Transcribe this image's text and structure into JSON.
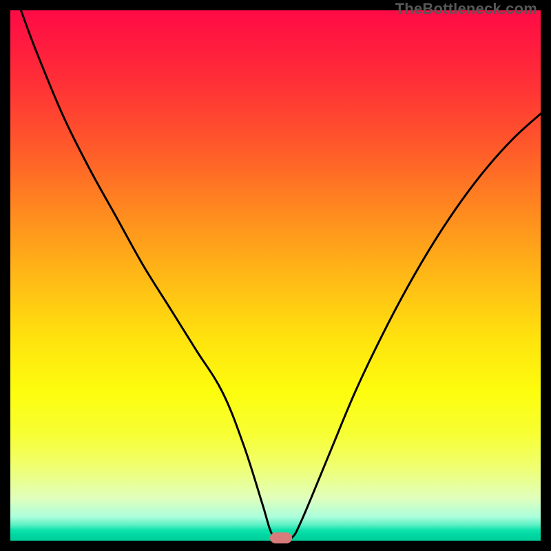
{
  "watermark": "TheBottleneck.com",
  "chart_data": {
    "type": "line",
    "title": "",
    "xlabel": "",
    "ylabel": "",
    "xlim": [
      0,
      100
    ],
    "ylim": [
      0,
      100
    ],
    "legend": false,
    "grid": false,
    "series": [
      {
        "name": "curve",
        "x": [
          2,
          5,
          10,
          15,
          20,
          25,
          30,
          35,
          40,
          44,
          47.5,
          49,
          50,
          51,
          53,
          55,
          60,
          65,
          70,
          75,
          80,
          85,
          90,
          95,
          100
        ],
        "y": [
          100,
          92,
          80,
          70,
          61,
          52,
          44,
          36,
          28,
          18,
          7,
          2,
          0.5,
          0.5,
          0.5,
          4,
          16,
          28,
          38.5,
          48,
          56.5,
          64,
          70.5,
          76,
          80.5
        ]
      }
    ],
    "marker": {
      "x": 51,
      "y": 0.5,
      "color": "#d77b7b"
    },
    "background_gradient": {
      "top": "#ff0b46",
      "mid": "#ffd60a",
      "bottom": "#00ce9a"
    }
  }
}
